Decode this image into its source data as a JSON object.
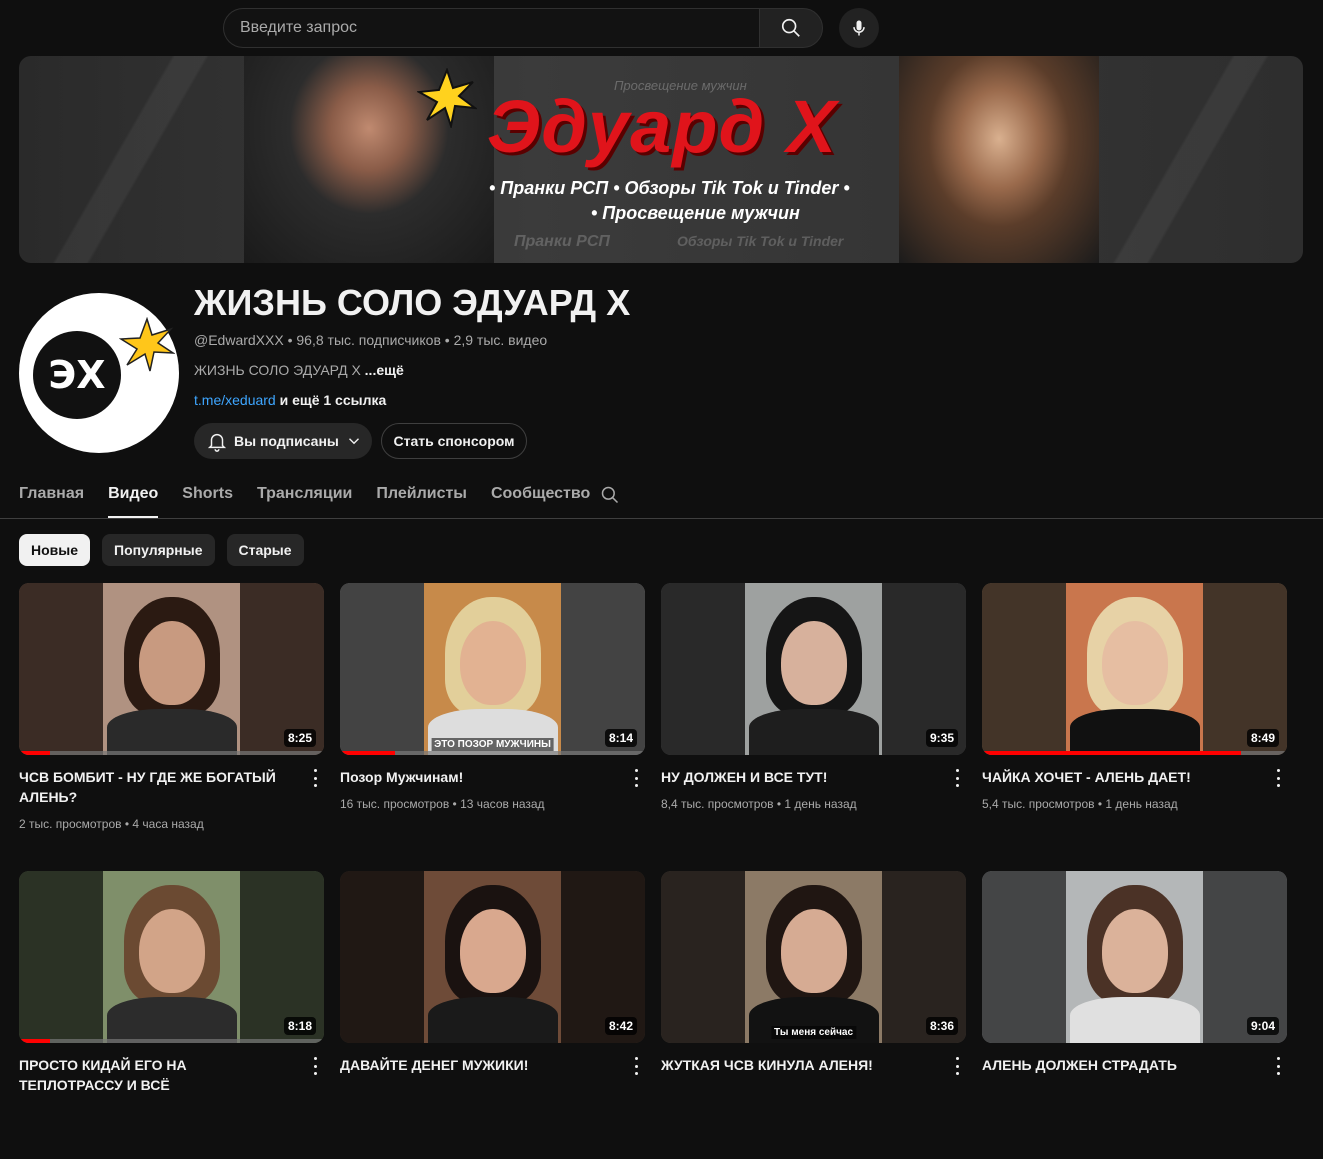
{
  "search": {
    "placeholder": "Введите запрос"
  },
  "banner": {
    "tagline_top": "Просвещение мужчин",
    "title": "Эдуард Х",
    "line1": "• Пранки РСП • Обзоры Tik Tok и Tinder •",
    "line2": "• Просвещение мужчин",
    "ghost1": "Пранки РСП",
    "ghost2": "Обзоры Tik Tok и Tinder"
  },
  "channel": {
    "avatar_text": "ЭХ",
    "name": "ЖИЗНЬ СОЛО ЭДУАРД Х",
    "handle": "@EdwardXXX",
    "subscribers": "96,8 тыс. подписчиков",
    "videos_count": "2,9 тыс. видео",
    "meta_sep": " • ",
    "description": "ЖИЗНЬ СОЛО ЭДУАРД Х",
    "more": "...ещё",
    "link": "t.me/xeduard",
    "more_links": "и ещё 1 ссылка",
    "subscribed_label": "Вы подписаны",
    "sponsor_label": "Стать спонсором"
  },
  "tabs": [
    {
      "label": "Главная",
      "active": false
    },
    {
      "label": "Видео",
      "active": true
    },
    {
      "label": "Shorts",
      "active": false
    },
    {
      "label": "Трансляции",
      "active": false
    },
    {
      "label": "Плейлисты",
      "active": false
    },
    {
      "label": "Сообщество",
      "active": false
    }
  ],
  "chips": [
    {
      "label": "Новые",
      "active": true
    },
    {
      "label": "Популярные",
      "active": false
    },
    {
      "label": "Старые",
      "active": false
    }
  ],
  "videos": [
    {
      "title": "ЧСВ БОМБИТ - НУ ГДЕ ЖЕ БОГАТЫЙ АЛЕНЬ?",
      "views": "2 тыс. просмотров",
      "age": "4 часа назад",
      "duration": "8:25",
      "progress": 0.1,
      "caption": "",
      "bg": "#6b5043",
      "center": "#b09281",
      "hair": "#2b1a12",
      "skin": "#c89a80",
      "torso": "#2a2a2a"
    },
    {
      "title": "Позор Мужчинам!",
      "views": "16 тыс. просмотров",
      "age": "13 часов назад",
      "duration": "8:14",
      "progress": 0.18,
      "caption": "ЭТО ПОЗОР МУЖЧИНЫ",
      "bg": "#7a7a7a",
      "center": "#c78a4a",
      "hair": "#e2cf9a",
      "skin": "#e2b292",
      "torso": "#ddd"
    },
    {
      "title": "НУ ДОЛЖЕН И ВСЕ ТУТ!",
      "views": "8,4 тыс. просмотров",
      "age": "1 день назад",
      "duration": "9:35",
      "progress": 0,
      "caption": "",
      "bg": "#4b4b4b",
      "center": "#9ea1a0",
      "hair": "#151515",
      "skin": "#d7b19c",
      "torso": "#1e1e1e"
    },
    {
      "title": "ЧАЙКА ХОЧЕТ - АЛЕНЬ ДАЕТ!",
      "views": "5,4 тыс. просмотров",
      "age": "1 день назад",
      "duration": "8:49",
      "progress": 0.85,
      "caption": "",
      "bg": "#7a5f48",
      "center": "#c9764d",
      "hair": "#e7d2a6",
      "skin": "#e6bea2",
      "torso": "#111"
    },
    {
      "title": "ПРОСТО КИДАЙ ЕГО НА ТЕПЛОТРАССУ И ВСЁ",
      "views": "",
      "age": "",
      "duration": "8:18",
      "progress": 0.1,
      "caption": "",
      "bg": "#4e5a44",
      "center": "#7f8f6a",
      "hair": "#6b4a32",
      "skin": "#d2a488",
      "torso": "#2c2c2c"
    },
    {
      "title": "ДАВАЙТЕ ДЕНЕГ МУЖИКИ!",
      "views": "",
      "age": "",
      "duration": "8:42",
      "progress": 0,
      "caption": "",
      "bg": "#3a2c25",
      "center": "#6e4b38",
      "hair": "#1a1210",
      "skin": "#d9a88e",
      "torso": "#1a1a1a"
    },
    {
      "title": "ЖУТКАЯ ЧСВ КИНУЛА АЛЕНЯ!",
      "views": "",
      "age": "",
      "duration": "8:36",
      "progress": 0,
      "caption": "Ты меня сейчас",
      "bg": "#4a4038",
      "center": "#8c7a66",
      "hair": "#201612",
      "skin": "#d6ab93",
      "torso": "#121212"
    },
    {
      "title": "АЛЕНЬ ДОЛЖЕН СТРАДАТЬ",
      "views": "",
      "age": "",
      "duration": "9:04",
      "progress": 0,
      "caption": "",
      "bg": "#7b7e80",
      "center": "#b4b7b8",
      "hair": "#4b3226",
      "skin": "#dbb29a",
      "torso": "#e0e0e0"
    }
  ]
}
